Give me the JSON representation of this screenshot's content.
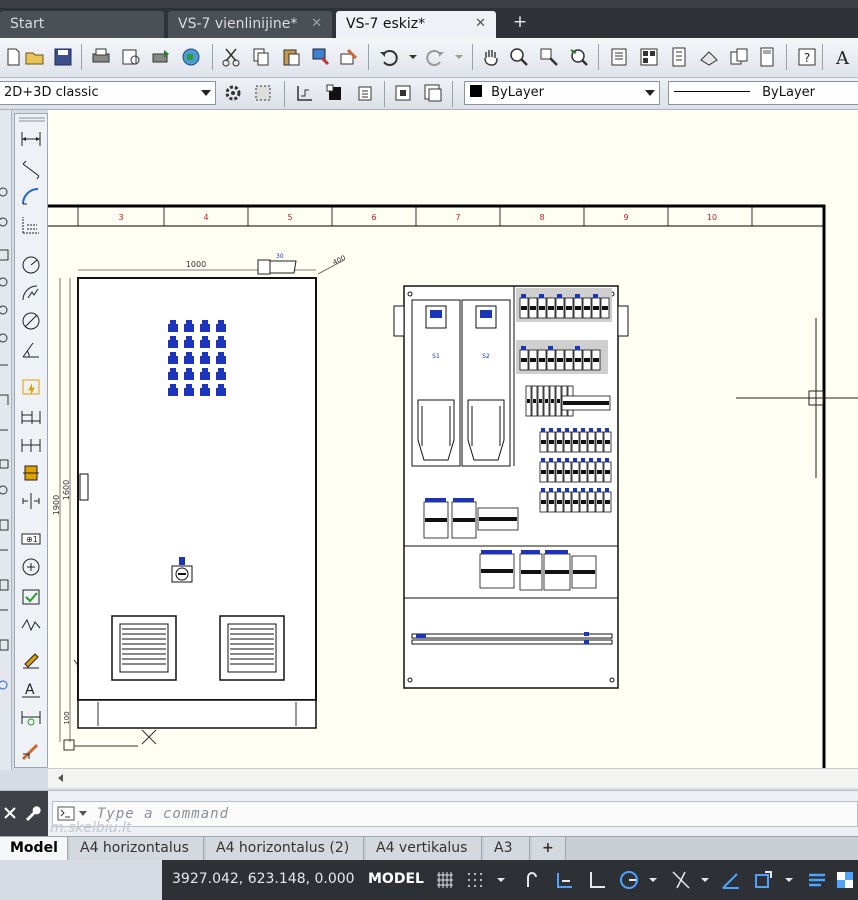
{
  "tabs": [
    {
      "label": "Start"
    },
    {
      "label": "VS-7 vienlinijine*",
      "close": "✕"
    },
    {
      "label": "VS-7 eskiz*",
      "close": "✕"
    }
  ],
  "new_tab": "+",
  "workspace": {
    "value": "2D+3D classic"
  },
  "color_combo": {
    "value": "ByLayer"
  },
  "linetype_combo": {
    "value": "ByLayer"
  },
  "drawing": {
    "column_labels": [
      "3",
      "4",
      "5",
      "6",
      "7",
      "8",
      "9",
      "10"
    ],
    "dim_width": "1000",
    "dim_height": "1600",
    "dim_height_total": "1900",
    "dim_depth": "400",
    "dim_plinth": "100",
    "dim_small": "30",
    "drive_label_1": "S1",
    "drive_label_2": "S2"
  },
  "command": {
    "placeholder": "Type a command"
  },
  "watermark": "m.skelbiu.lt",
  "layout_tabs": [
    {
      "label": "Model"
    },
    {
      "label": "A4 horizontalus"
    },
    {
      "label": "A4 horizontalus (2)"
    },
    {
      "label": "A4 vertikalus"
    },
    {
      "label": "A3"
    },
    {
      "label": "+"
    }
  ],
  "status": {
    "coordinates": "3927.042, 623.148, 0.000",
    "space": "MODEL"
  },
  "colors": {
    "canvas": "#fffef3",
    "accent_blue": "#1c35b8",
    "dark_ui": "#2d3035"
  }
}
